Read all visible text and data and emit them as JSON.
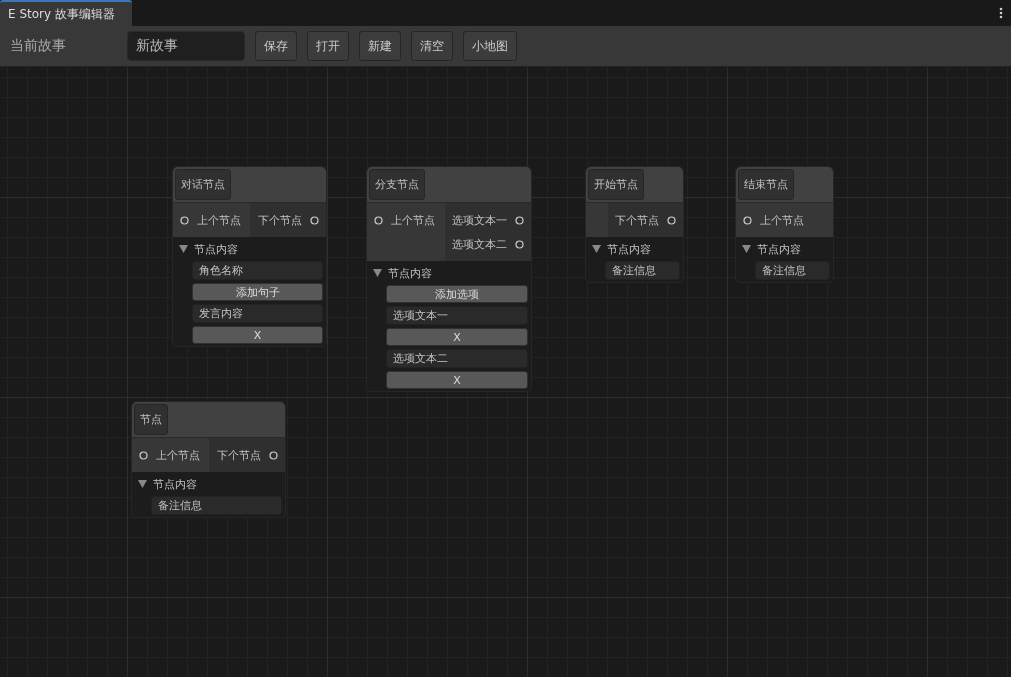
{
  "window": {
    "tab": "E Story 故事编辑器"
  },
  "toolbar": {
    "label": "当前故事",
    "story_name": "新故事",
    "buttons": [
      "保存",
      "打开",
      "新建",
      "清空",
      "小地图"
    ]
  },
  "nodes": [
    {
      "title": "对话节点",
      "input": "上个节点",
      "outputs": [
        "下个节点"
      ],
      "section": {
        "label": "节点内容",
        "expanded": true,
        "items": [
          {
            "kind": "field",
            "text": "角色名称"
          },
          {
            "kind": "button",
            "text": "添加句子"
          },
          {
            "kind": "field",
            "text": "发言内容"
          },
          {
            "kind": "button",
            "text": "X"
          }
        ]
      }
    },
    {
      "title": "分支节点",
      "input": "上个节点",
      "outputs": [
        "选项文本一",
        "选项文本二"
      ],
      "section": {
        "label": "节点内容",
        "expanded": true,
        "items": [
          {
            "kind": "button",
            "text": "添加选项"
          },
          {
            "kind": "field",
            "text": "选项文本一"
          },
          {
            "kind": "button",
            "text": "X"
          },
          {
            "kind": "field",
            "text": "选项文本二"
          },
          {
            "kind": "button",
            "text": "X"
          }
        ]
      }
    },
    {
      "title": "开始节点",
      "outputs": [
        "下个节点"
      ],
      "section": {
        "label": "节点内容",
        "expanded": true,
        "items": [
          {
            "kind": "field",
            "text": "备注信息"
          }
        ]
      }
    },
    {
      "title": "结束节点",
      "input": "上个节点",
      "section": {
        "label": "节点内容",
        "expanded": true,
        "items": [
          {
            "kind": "field",
            "text": "备注信息"
          }
        ]
      }
    },
    {
      "title": "节点",
      "input": "上个节点",
      "outputs": [
        "下个节点"
      ],
      "section": {
        "label": "节点内容",
        "expanded": true,
        "items": [
          {
            "kind": "field",
            "text": "备注信息"
          }
        ]
      }
    }
  ]
}
